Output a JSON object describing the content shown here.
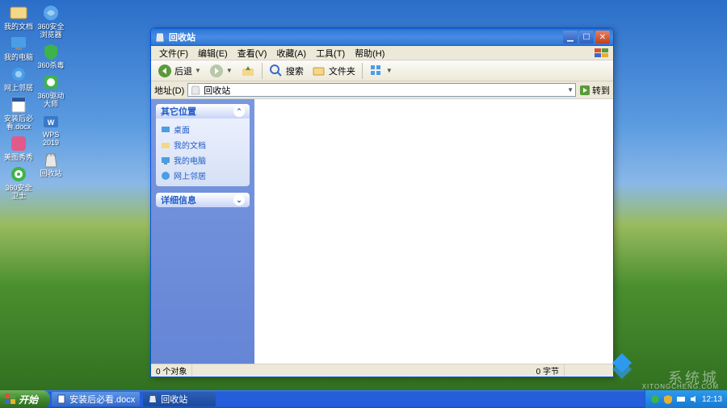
{
  "desktop": {
    "col1": [
      {
        "label": "我的文档",
        "color": "#4a9ee5"
      },
      {
        "label": "我的电脑",
        "color": "#4a9ee5"
      },
      {
        "label": "网上邻居",
        "color": "#4a9ee5"
      },
      {
        "label": "安装后必看.docx",
        "color": "#d97c2e"
      },
      {
        "label": "美图秀秀",
        "color": "#e05a8a"
      },
      {
        "label": "360安全卫士",
        "color": "#3eb34a"
      }
    ],
    "col2": [
      {
        "label": "360安全浏览器",
        "color": "#5aa5e8"
      },
      {
        "label": "360杀毒",
        "color": "#3eb34a"
      },
      {
        "label": "360驱动大师",
        "color": "#3eb34a"
      },
      {
        "label": "WPS 2019",
        "color": "#3a78c8"
      },
      {
        "label": "回收站",
        "color": "#c5c5c5"
      }
    ]
  },
  "window": {
    "title": "回收站",
    "menu": [
      "文件(F)",
      "编辑(E)",
      "查看(V)",
      "收藏(A)",
      "工具(T)",
      "帮助(H)"
    ],
    "toolbar": {
      "back": "后退",
      "search": "搜索",
      "folders": "文件夹"
    },
    "address": {
      "label": "地址(D)",
      "value": "回收站",
      "go": "转到"
    },
    "sidebar": {
      "panel1": {
        "title": "其它位置",
        "links": [
          "桌面",
          "我的文档",
          "我的电脑",
          "网上邻居"
        ]
      },
      "panel2": {
        "title": "详细信息"
      }
    },
    "status": {
      "left": "0 个对象",
      "right": "0 字节"
    }
  },
  "taskbar": {
    "start": "开始",
    "items": [
      {
        "label": "安装后必看.docx",
        "active": false
      },
      {
        "label": "回收站",
        "active": true
      }
    ],
    "clock": "12:13"
  },
  "watermark": {
    "text": "系统城",
    "url": "XITONGCHENG.COM"
  }
}
